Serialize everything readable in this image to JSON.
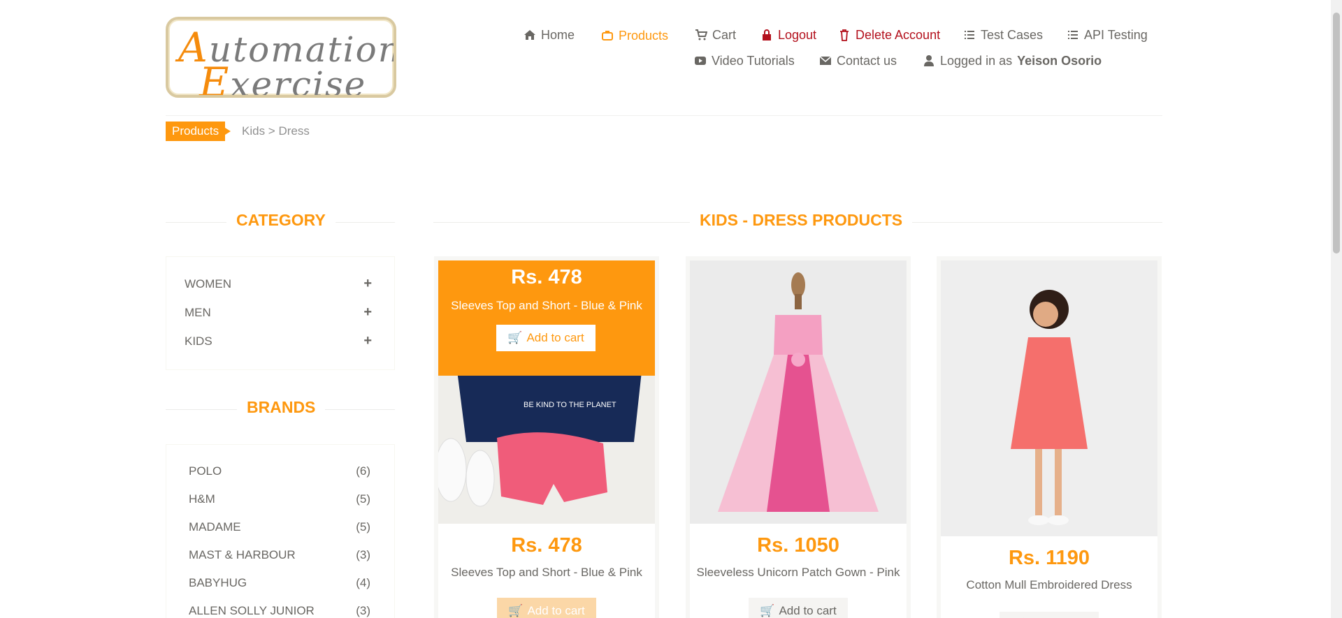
{
  "header": {
    "logo": "AutomationExercise",
    "nav": [
      {
        "key": "home",
        "label": "Home",
        "icon": "home-icon"
      },
      {
        "key": "products",
        "label": "Products",
        "icon": "briefcase-icon"
      },
      {
        "key": "cart",
        "label": "Cart",
        "icon": "cart-icon"
      },
      {
        "key": "logout",
        "label": "Logout",
        "icon": "lock-icon"
      },
      {
        "key": "delete",
        "label": "Delete Account",
        "icon": "trash-icon"
      },
      {
        "key": "testcases",
        "label": "Test Cases",
        "icon": "list-icon"
      },
      {
        "key": "api",
        "label": "API Testing",
        "icon": "list-icon"
      },
      {
        "key": "video",
        "label": "Video Tutorials",
        "icon": "youtube-play-icon"
      },
      {
        "key": "contact",
        "label": "Contact us",
        "icon": "envelope-icon"
      }
    ],
    "logged_in_prefix": "Logged in as",
    "logged_in_user": "Yeison Osorio"
  },
  "breadcrumb": {
    "active": "Products",
    "path": "Kids > Dress"
  },
  "sidebar": {
    "category_title": "CATEGORY",
    "categories": [
      "WOMEN",
      "MEN",
      "KIDS"
    ],
    "brands_title": "BRANDS",
    "brands": [
      {
        "name": "POLO",
        "count": "(6)"
      },
      {
        "name": "H&M",
        "count": "(5)"
      },
      {
        "name": "MADAME",
        "count": "(5)"
      },
      {
        "name": "MAST & HARBOUR",
        "count": "(3)"
      },
      {
        "name": "BABYHUG",
        "count": "(4)"
      },
      {
        "name": "ALLEN SOLLY JUNIOR",
        "count": "(3)"
      }
    ]
  },
  "main": {
    "title": "KIDS - DRESS PRODUCTS",
    "add_to_cart": "Add to cart",
    "products": [
      {
        "price": "Rs. 478",
        "name": "Sleeves Top and Short - Blue & Pink",
        "image_text": "BE KIND TO THE PLANET"
      },
      {
        "price": "Rs. 1050",
        "name": "Sleeveless Unicorn Patch Gown - Pink"
      },
      {
        "price": "Rs. 1190",
        "name": "Cotton Mull Embroidered Dress"
      }
    ]
  },
  "colors": {
    "accent": "#fe980f",
    "danger": "#b3101c",
    "text": "#696763"
  }
}
